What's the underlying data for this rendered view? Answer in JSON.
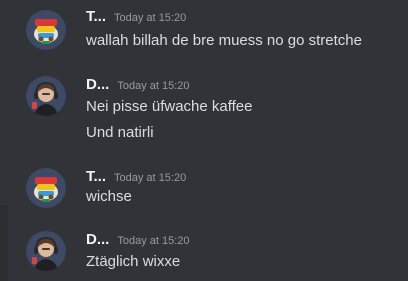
{
  "messages": [
    {
      "username": "T...",
      "timestamp": "Today at 15:20",
      "lines": [
        "wallah billah de bre muess no go stretche"
      ],
      "avatar": "cartoon-logo-avatar"
    },
    {
      "username": "D...",
      "timestamp": "Today at 15:20",
      "lines": [
        "Nei pisse üfwache kaffee",
        "Und natirli"
      ],
      "avatar": "headset-person-avatar"
    },
    {
      "username": "T...",
      "timestamp": "Today at 15:20",
      "lines": [
        "wichse"
      ],
      "avatar": "cartoon-logo-avatar"
    },
    {
      "username": "D...",
      "timestamp": "Today at 15:20",
      "lines": [
        "Ztäglich wixxe"
      ],
      "avatar": "headset-person-avatar"
    }
  ],
  "colors": {
    "background": "#313338",
    "username": "#f2f3f5",
    "timestamp": "#949ba4",
    "message_text": "#dbdee1",
    "avatar_background": "#3e4a63"
  }
}
